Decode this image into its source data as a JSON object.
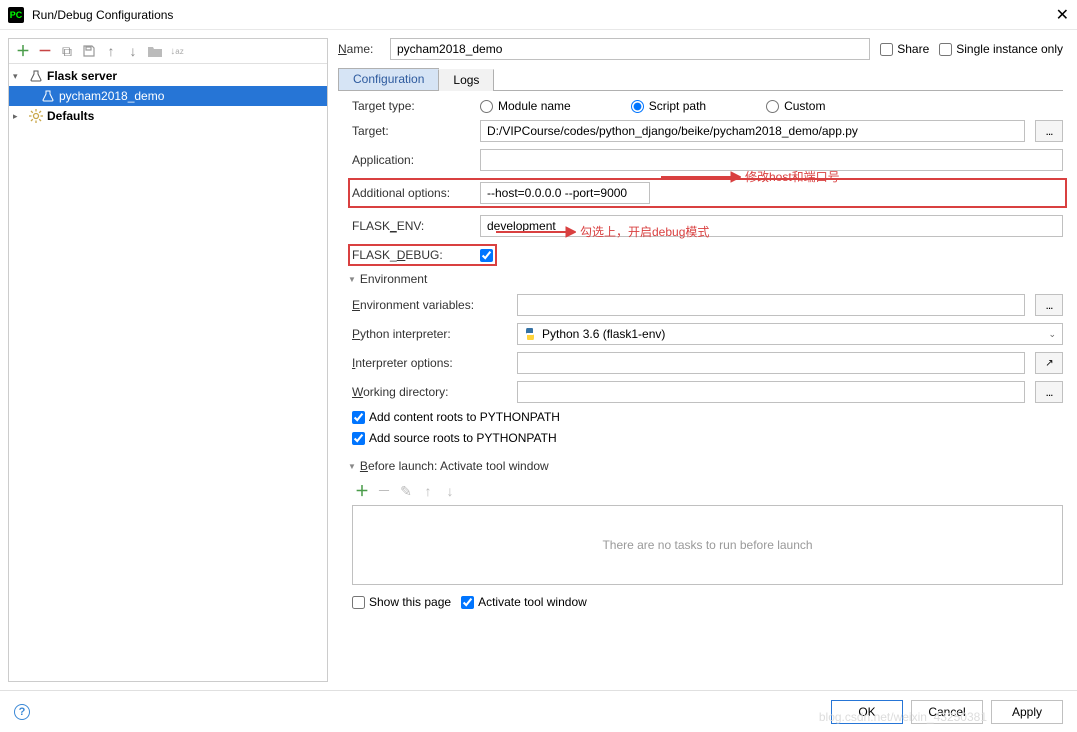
{
  "window": {
    "title": "Run/Debug Configurations"
  },
  "tree": {
    "flask_server": "Flask server",
    "config_item": "pycham2018_demo",
    "defaults": "Defaults"
  },
  "form": {
    "name_label": "Name:",
    "name_value": "pycham2018_demo",
    "share_label": "Share",
    "single_instance_label": "Single instance only",
    "tabs": {
      "configuration": "Configuration",
      "logs": "Logs"
    },
    "target_type_label": "Target type:",
    "target_type": {
      "module": "Module name",
      "script": "Script path",
      "custom": "Custom"
    },
    "target_label": "Target:",
    "target_value": "D:/VIPCourse/codes/python_django/beike/pycham2018_demo/app.py",
    "application_label": "Application:",
    "application_value": "",
    "additional_label": "Additional options:",
    "additional_value": "--host=0.0.0.0 --port=9000",
    "flask_env_label": "FLASK_ENV:",
    "flask_env_value": "development",
    "flask_debug_label": "FLASK_DEBUG:",
    "env_section": "Environment",
    "env_vars_label": "Environment variables:",
    "env_vars_value": "",
    "py_interp_label": "Python interpreter:",
    "py_interp_value": "Python 3.6 (flask1-env)",
    "interp_opts_label": "Interpreter options:",
    "interp_opts_value": "",
    "workdir_label": "Working directory:",
    "workdir_value": "",
    "add_content_roots": "Add content roots to PYTHONPATH",
    "add_source_roots": "Add source roots to PYTHONPATH",
    "before_launch_section": "Before launch: Activate tool window",
    "no_tasks": "There are no tasks to run before launch",
    "show_this_page": "Show this page",
    "activate_tool_window": "Activate tool window"
  },
  "annotations": {
    "host_port": "修改host和端口号",
    "debug_mode": "勾选上，开启debug模式"
  },
  "footer": {
    "ok": "OK",
    "cancel": "Cancel",
    "apply": "Apply"
  },
  "watermark": "blog.csdn.net/weixin_43250381"
}
